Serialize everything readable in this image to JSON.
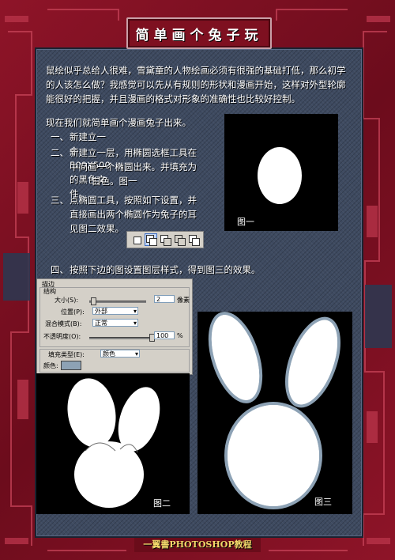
{
  "title": "简单画个兔子玩",
  "intro": "鼠绘似乎总给人很难，雪黛童的人物绘画必须有很强的基础打低，那么初学的人该怎么做？我感觉可以先从有规则的形状和漫画开始，这样对外型轮廓能很好的把握，并且漫画的格式对形象的准确性也比较好控制。",
  "now_text": "现在我们就简单画个漫画兔子出来。",
  "steps": [
    {
      "num": "一、",
      "lines": [
        "新建立一个500X500的黑色文件。"
      ]
    },
    {
      "num": "二、",
      "lines": [
        "新建立一层，用椭圆选框工具在",
        "中间画一个椭圆出来。并填充为",
        "白色。图一"
      ]
    },
    {
      "num": "三、",
      "lines": [
        "点椭圆工具，按照如下设置，并",
        "直接画出两个椭圆作为兔子的耳",
        "见图二效果。"
      ]
    },
    {
      "num": "四、",
      "lines": [
        "按照下边的图设置图层样式，得到图三的效果。"
      ]
    }
  ],
  "figure_captions": {
    "fig1": "图一",
    "fig2": "图二",
    "fig3": "图三"
  },
  "dialog": {
    "section_title": "描边",
    "group_title": "结构",
    "size_label": "大小(S):",
    "size_value": "2",
    "size_unit": "像素",
    "position_label": "位置(P):",
    "position_value": "外部",
    "blend_label": "混合模式(B):",
    "blend_value": "正常",
    "opacity_label": "不透明度(O):",
    "opacity_value": "100",
    "opacity_unit": "%",
    "fill_type_label": "填充类型(E):",
    "fill_type_value": "颜色",
    "color_label": "颜色:",
    "stroke_color": "#8da2b5"
  },
  "toolset_icons": [
    "new-selection-icon",
    "add-selection-icon",
    "subtract-selection-icon",
    "intersect-selection-icon",
    "exclude-selection-icon"
  ],
  "footer": "一翼書PHOTOSHOP教程",
  "colors": {
    "frame": "#7e1020",
    "panel": "#3e4a60",
    "footer_text": "#f2d86a"
  }
}
